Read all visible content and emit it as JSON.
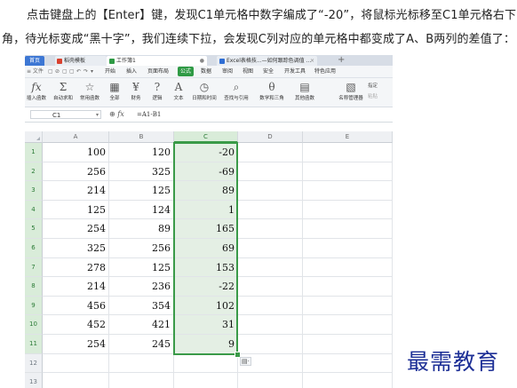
{
  "instruction": {
    "line1": "点击键盘上的【Enter】键，发现C1单元格中数字编成了“-20”，将鼠标光标移至C1单元格右下",
    "line2": "角，待光标变成“黑十字”，我们连续下拉，会发现C列对应的单元格中都变成了A、B两列的差值了："
  },
  "tabs": [
    {
      "label": "首页",
      "icon": "home-icon"
    },
    {
      "label": "稻壳模板",
      "icon": "docer-icon",
      "color": "#d9412f"
    },
    {
      "label": "工作簿1",
      "icon": "sheet-icon",
      "color": "#2f9a45"
    },
    {
      "label": "Excel表格技...—如何跟踪色调值 ...",
      "icon": "sheet-icon",
      "color": "#2f6ed4"
    }
  ],
  "new_tab": "+",
  "ribbon": {
    "quick": [
      "≡ 文件",
      "▢",
      "⊘",
      "▢",
      "▢",
      "↶",
      "↷",
      "▾"
    ],
    "tabs": [
      "开始",
      "插入",
      "页面布局",
      "公式",
      "数据",
      "审阅",
      "视图",
      "安全",
      "开发工具",
      "特色应用"
    ],
    "active_tab": "公式",
    "buttons": [
      {
        "label": "插入函数",
        "glyph": "fx"
      },
      {
        "label": "自动求和",
        "glyph": "Σ"
      },
      {
        "label": "常用函数",
        "glyph": "☆"
      },
      {
        "label": "全部",
        "glyph": "▦"
      },
      {
        "label": "财务",
        "glyph": "¥"
      },
      {
        "label": "逻辑",
        "glyph": "?"
      },
      {
        "label": "文本",
        "glyph": "A"
      },
      {
        "label": "日期和时间",
        "glyph": "◷"
      },
      {
        "label": "查找与引用",
        "glyph": "⌕"
      },
      {
        "label": "数学和三角",
        "glyph": "θ"
      },
      {
        "label": "其他函数",
        "glyph": "▤"
      },
      {
        "label": "名称管理器",
        "glyph": "▧"
      }
    ],
    "side_options": [
      "指定",
      "粘贴"
    ]
  },
  "formula_bar": {
    "name_box": "C1",
    "icons": "⊕ fx",
    "formula": "=A1-B1"
  },
  "columns": [
    "A",
    "B",
    "C",
    "D",
    "E"
  ],
  "selected_column": "C",
  "rows": [
    {
      "num": "1",
      "a": "100",
      "b": "120",
      "c": "-20"
    },
    {
      "num": "2",
      "a": "256",
      "b": "325",
      "c": "-69"
    },
    {
      "num": "3",
      "a": "214",
      "b": "125",
      "c": "89"
    },
    {
      "num": "4",
      "a": "125",
      "b": "124",
      "c": "1"
    },
    {
      "num": "5",
      "a": "254",
      "b": "89",
      "c": "165"
    },
    {
      "num": "6",
      "a": "325",
      "b": "256",
      "c": "69"
    },
    {
      "num": "7",
      "a": "278",
      "b": "125",
      "c": "153"
    },
    {
      "num": "8",
      "a": "214",
      "b": "236",
      "c": "-22"
    },
    {
      "num": "9",
      "a": "456",
      "b": "354",
      "c": "102"
    },
    {
      "num": "10",
      "a": "452",
      "b": "421",
      "c": "31"
    },
    {
      "num": "11",
      "a": "254",
      "b": "245",
      "c": "9"
    },
    {
      "num": "12",
      "a": "",
      "b": "",
      "c": ""
    },
    {
      "num": "13",
      "a": "",
      "b": "",
      "c": ""
    }
  ],
  "paste_options_glyph": "▤·",
  "watermark": "最需教育"
}
